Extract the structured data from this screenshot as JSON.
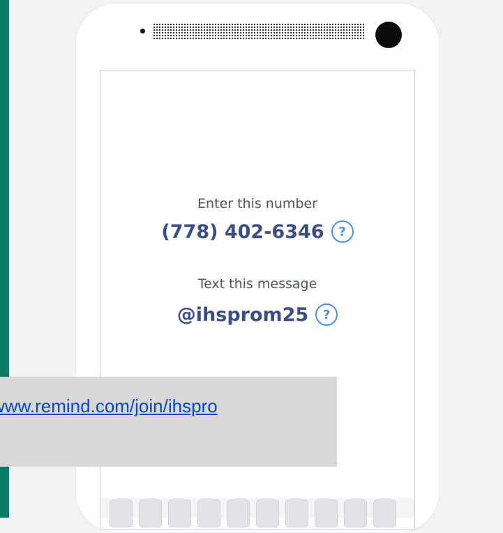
{
  "instructions": {
    "number_label": "Enter this number",
    "phone_number": "(778) 402-6346",
    "message_label": "Text this message",
    "message_code": "@ihsprom25",
    "help_glyph": "?"
  },
  "link": {
    "text": "www.remind.com/join/ihspro"
  },
  "colors": {
    "left_bar": "#0f7a63",
    "value_text": "#3c4e86",
    "help_icon": "#4a90e2",
    "link": "#0b46c6"
  },
  "keyboard": {
    "key_count": 10
  }
}
